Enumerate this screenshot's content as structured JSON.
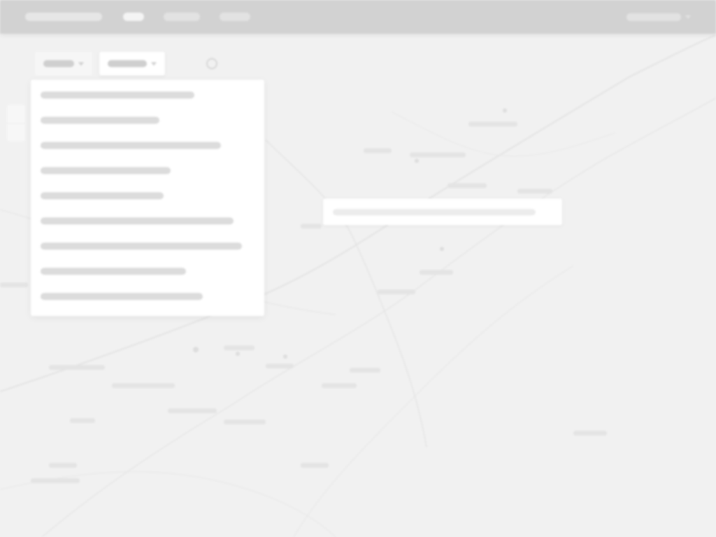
{
  "navbar": {
    "brand": "",
    "links": [
      {
        "label": "",
        "active": true
      },
      {
        "label": "",
        "active": false
      },
      {
        "label": "",
        "active": false
      }
    ],
    "user_label": ""
  },
  "toolbar": {
    "layer_button_label": "",
    "filter_button_label": "",
    "icons": [
      "layers-icon",
      "settings-icon"
    ]
  },
  "dropdown": {
    "items": [
      {
        "label": ""
      },
      {
        "label": ""
      },
      {
        "label": ""
      },
      {
        "label": ""
      },
      {
        "label": ""
      },
      {
        "label": ""
      },
      {
        "label": ""
      },
      {
        "label": ""
      },
      {
        "label": ""
      }
    ]
  },
  "search": {
    "value": "",
    "placeholder": ""
  },
  "colors": {
    "navbar_bg": "#d2d2d2",
    "map_bg": "#f1f1f1",
    "panel_bg": "#ffffff"
  }
}
